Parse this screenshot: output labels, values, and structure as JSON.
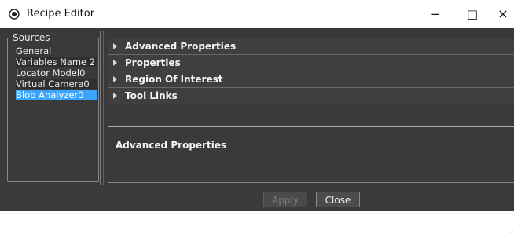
{
  "window": {
    "title": "Recipe Editor",
    "icons": {
      "app": "recipe-editor-icon",
      "minimize": "minimize-icon",
      "maximize": "maximize-icon",
      "close": "close-icon"
    }
  },
  "sources": {
    "legend": "Sources",
    "items": [
      {
        "label": "General",
        "selected": false
      },
      {
        "label": "Variables Name 2",
        "selected": false
      },
      {
        "label": "Locator Model0",
        "selected": false
      },
      {
        "label": "Virtual Camera0",
        "selected": false
      },
      {
        "label": "Blob Analyzer0",
        "selected": true
      }
    ]
  },
  "properties": {
    "sections": [
      {
        "label": "Advanced Properties"
      },
      {
        "label": "Properties"
      },
      {
        "label": "Region Of Interest"
      },
      {
        "label": "Tool Links"
      }
    ],
    "description_title": "Advanced Properties"
  },
  "buttons": {
    "apply": "Apply",
    "close": "Close"
  },
  "colors": {
    "window_bg": "#3a3a3a",
    "titlebar_bg": "#ffffff",
    "selection": "#39a5ff"
  }
}
